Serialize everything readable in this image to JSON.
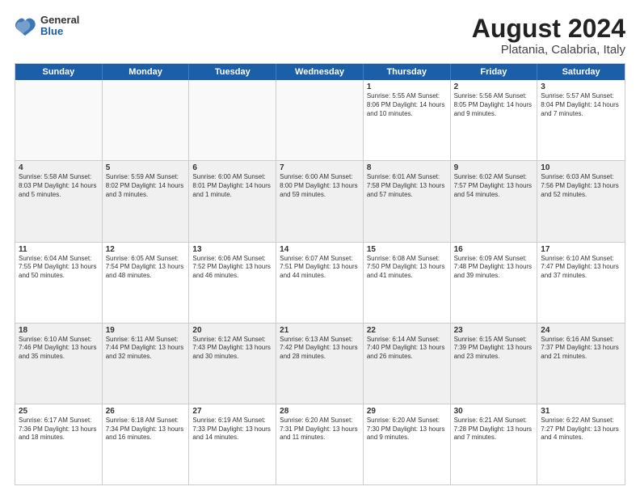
{
  "header": {
    "logo": {
      "general": "General",
      "blue": "Blue"
    },
    "title": "August 2024",
    "subtitle": "Platania, Calabria, Italy"
  },
  "calendar": {
    "days_of_week": [
      "Sunday",
      "Monday",
      "Tuesday",
      "Wednesday",
      "Thursday",
      "Friday",
      "Saturday"
    ],
    "rows": [
      [
        {
          "day": "",
          "text": "",
          "empty": true
        },
        {
          "day": "",
          "text": "",
          "empty": true
        },
        {
          "day": "",
          "text": "",
          "empty": true
        },
        {
          "day": "",
          "text": "",
          "empty": true
        },
        {
          "day": "1",
          "text": "Sunrise: 5:55 AM\nSunset: 8:06 PM\nDaylight: 14 hours and 10 minutes.",
          "empty": false
        },
        {
          "day": "2",
          "text": "Sunrise: 5:56 AM\nSunset: 8:05 PM\nDaylight: 14 hours and 9 minutes.",
          "empty": false
        },
        {
          "day": "3",
          "text": "Sunrise: 5:57 AM\nSunset: 8:04 PM\nDaylight: 14 hours and 7 minutes.",
          "empty": false
        }
      ],
      [
        {
          "day": "4",
          "text": "Sunrise: 5:58 AM\nSunset: 8:03 PM\nDaylight: 14 hours and 5 minutes.",
          "empty": false
        },
        {
          "day": "5",
          "text": "Sunrise: 5:59 AM\nSunset: 8:02 PM\nDaylight: 14 hours and 3 minutes.",
          "empty": false
        },
        {
          "day": "6",
          "text": "Sunrise: 6:00 AM\nSunset: 8:01 PM\nDaylight: 14 hours and 1 minute.",
          "empty": false
        },
        {
          "day": "7",
          "text": "Sunrise: 6:00 AM\nSunset: 8:00 PM\nDaylight: 13 hours and 59 minutes.",
          "empty": false
        },
        {
          "day": "8",
          "text": "Sunrise: 6:01 AM\nSunset: 7:58 PM\nDaylight: 13 hours and 57 minutes.",
          "empty": false
        },
        {
          "day": "9",
          "text": "Sunrise: 6:02 AM\nSunset: 7:57 PM\nDaylight: 13 hours and 54 minutes.",
          "empty": false
        },
        {
          "day": "10",
          "text": "Sunrise: 6:03 AM\nSunset: 7:56 PM\nDaylight: 13 hours and 52 minutes.",
          "empty": false
        }
      ],
      [
        {
          "day": "11",
          "text": "Sunrise: 6:04 AM\nSunset: 7:55 PM\nDaylight: 13 hours and 50 minutes.",
          "empty": false
        },
        {
          "day": "12",
          "text": "Sunrise: 6:05 AM\nSunset: 7:54 PM\nDaylight: 13 hours and 48 minutes.",
          "empty": false
        },
        {
          "day": "13",
          "text": "Sunrise: 6:06 AM\nSunset: 7:52 PM\nDaylight: 13 hours and 46 minutes.",
          "empty": false
        },
        {
          "day": "14",
          "text": "Sunrise: 6:07 AM\nSunset: 7:51 PM\nDaylight: 13 hours and 44 minutes.",
          "empty": false
        },
        {
          "day": "15",
          "text": "Sunrise: 6:08 AM\nSunset: 7:50 PM\nDaylight: 13 hours and 41 minutes.",
          "empty": false
        },
        {
          "day": "16",
          "text": "Sunrise: 6:09 AM\nSunset: 7:48 PM\nDaylight: 13 hours and 39 minutes.",
          "empty": false
        },
        {
          "day": "17",
          "text": "Sunrise: 6:10 AM\nSunset: 7:47 PM\nDaylight: 13 hours and 37 minutes.",
          "empty": false
        }
      ],
      [
        {
          "day": "18",
          "text": "Sunrise: 6:10 AM\nSunset: 7:46 PM\nDaylight: 13 hours and 35 minutes.",
          "empty": false
        },
        {
          "day": "19",
          "text": "Sunrise: 6:11 AM\nSunset: 7:44 PM\nDaylight: 13 hours and 32 minutes.",
          "empty": false
        },
        {
          "day": "20",
          "text": "Sunrise: 6:12 AM\nSunset: 7:43 PM\nDaylight: 13 hours and 30 minutes.",
          "empty": false
        },
        {
          "day": "21",
          "text": "Sunrise: 6:13 AM\nSunset: 7:42 PM\nDaylight: 13 hours and 28 minutes.",
          "empty": false
        },
        {
          "day": "22",
          "text": "Sunrise: 6:14 AM\nSunset: 7:40 PM\nDaylight: 13 hours and 26 minutes.",
          "empty": false
        },
        {
          "day": "23",
          "text": "Sunrise: 6:15 AM\nSunset: 7:39 PM\nDaylight: 13 hours and 23 minutes.",
          "empty": false
        },
        {
          "day": "24",
          "text": "Sunrise: 6:16 AM\nSunset: 7:37 PM\nDaylight: 13 hours and 21 minutes.",
          "empty": false
        }
      ],
      [
        {
          "day": "25",
          "text": "Sunrise: 6:17 AM\nSunset: 7:36 PM\nDaylight: 13 hours and 18 minutes.",
          "empty": false
        },
        {
          "day": "26",
          "text": "Sunrise: 6:18 AM\nSunset: 7:34 PM\nDaylight: 13 hours and 16 minutes.",
          "empty": false
        },
        {
          "day": "27",
          "text": "Sunrise: 6:19 AM\nSunset: 7:33 PM\nDaylight: 13 hours and 14 minutes.",
          "empty": false
        },
        {
          "day": "28",
          "text": "Sunrise: 6:20 AM\nSunset: 7:31 PM\nDaylight: 13 hours and 11 minutes.",
          "empty": false
        },
        {
          "day": "29",
          "text": "Sunrise: 6:20 AM\nSunset: 7:30 PM\nDaylight: 13 hours and 9 minutes.",
          "empty": false
        },
        {
          "day": "30",
          "text": "Sunrise: 6:21 AM\nSunset: 7:28 PM\nDaylight: 13 hours and 7 minutes.",
          "empty": false
        },
        {
          "day": "31",
          "text": "Sunrise: 6:22 AM\nSunset: 7:27 PM\nDaylight: 13 hours and 4 minutes.",
          "empty": false
        }
      ]
    ]
  }
}
